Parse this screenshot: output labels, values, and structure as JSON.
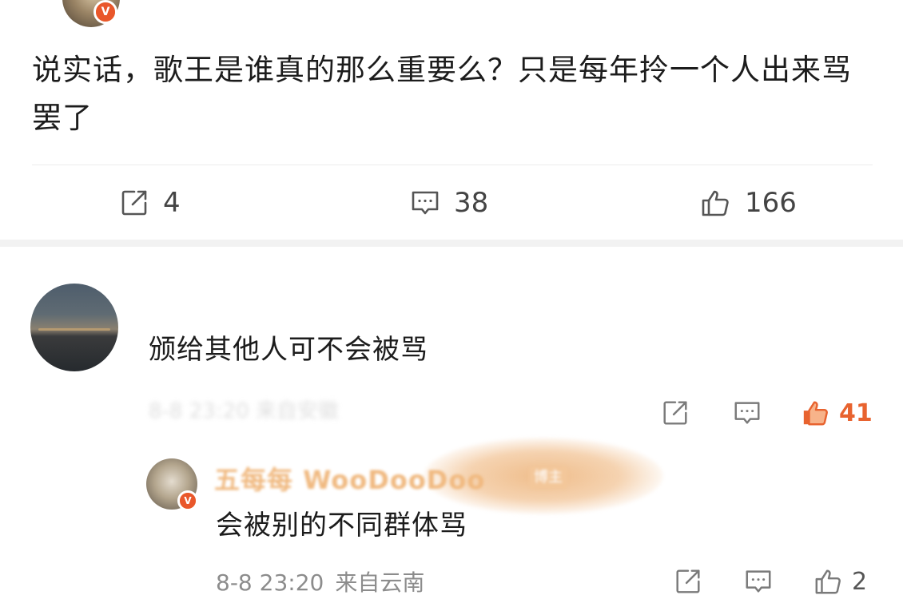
{
  "post": {
    "text": "说实话，歌王是谁真的那么重要么？只是每年拎一个人出来骂罢了",
    "badge": "V",
    "actions": {
      "share_count": "4",
      "comment_count": "38",
      "like_count": "166"
    }
  },
  "comment": {
    "text": "颁给其他人可不会被骂",
    "meta": "8-8 23:20 来自安徽",
    "like_count": "41"
  },
  "reply": {
    "author": "五每每 WooDooDoo",
    "tag": "博主",
    "badge": "V",
    "text": "会被别的不同群体骂",
    "time": "8-8 23:20",
    "location": "来自云南",
    "like_count": "2"
  },
  "colors": {
    "accent_orange": "#e8632f",
    "badge_red": "#e9572b",
    "badge_gold": "#f2a33a",
    "muted_text": "#8c8c8c"
  }
}
